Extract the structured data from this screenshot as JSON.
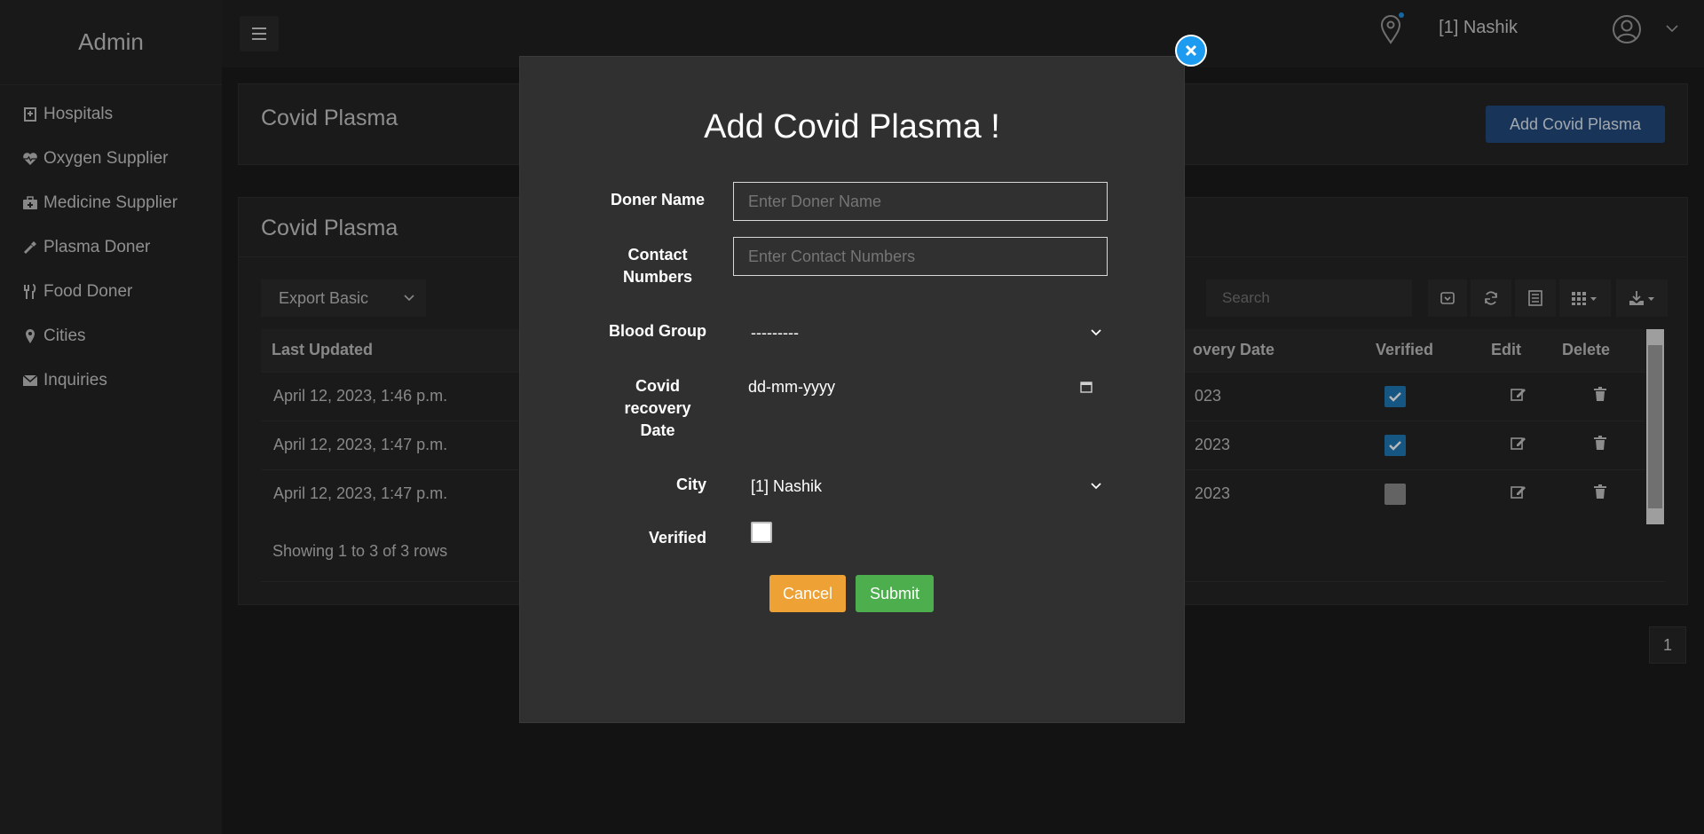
{
  "sidebar": {
    "brand": "Admin",
    "items": [
      {
        "label": "Hospitals",
        "icon": "hospital-icon"
      },
      {
        "label": "Oxygen Supplier",
        "icon": "heartbeat-icon"
      },
      {
        "label": "Medicine Supplier",
        "icon": "medkit-icon"
      },
      {
        "label": "Plasma Doner",
        "icon": "eyedropper-icon"
      },
      {
        "label": "Food Doner",
        "icon": "cutlery-icon"
      },
      {
        "label": "Cities",
        "icon": "map-marker-icon"
      },
      {
        "label": "Inquiries",
        "icon": "envelope-icon"
      }
    ]
  },
  "topbar": {
    "city": "[1] Nashik"
  },
  "header_panel": {
    "title": "Covid Plasma",
    "add_button": "Add Covid Plasma"
  },
  "table_panel": {
    "title": "Covid Plasma",
    "export_label": "Export Basic",
    "search_placeholder": "Search",
    "columns": [
      "Last Updated",
      "overy Date",
      "Verified",
      "Edit",
      "Delete"
    ],
    "rows": [
      {
        "last_updated": "April 12, 2023, 1:46 p.m.",
        "recovery_date": "023",
        "verified": true
      },
      {
        "last_updated": "April 12, 2023, 1:47 p.m.",
        "recovery_date": " 2023",
        "verified": true
      },
      {
        "last_updated": "April 12, 2023, 1:47 p.m.",
        "recovery_date": " 2023",
        "verified": false
      }
    ],
    "showing": "Showing 1 to 3 of 3 rows",
    "page": "1"
  },
  "modal": {
    "title": "Add Covid Plasma !",
    "fields": {
      "doner_name": {
        "label": "Doner Name",
        "placeholder": "Enter Doner Name"
      },
      "contact": {
        "label": "Contact Numbers",
        "placeholder": "Enter Contact Numbers"
      },
      "blood_group": {
        "label": "Blood Group",
        "value": "---------"
      },
      "recovery_date": {
        "label": "Covid recovery Date",
        "value": "dd-mm-yyyy"
      },
      "city": {
        "label": "City",
        "value": "[1] Nashik"
      },
      "verified": {
        "label": "Verified",
        "checked": false
      }
    },
    "cancel": "Cancel",
    "submit": "Submit"
  },
  "colors": {
    "primary_button": "#224a7c",
    "cancel": "#eea236",
    "submit": "#4cae4c",
    "close": "#1d9bf0",
    "checkbox_on": "#1f78b4"
  }
}
